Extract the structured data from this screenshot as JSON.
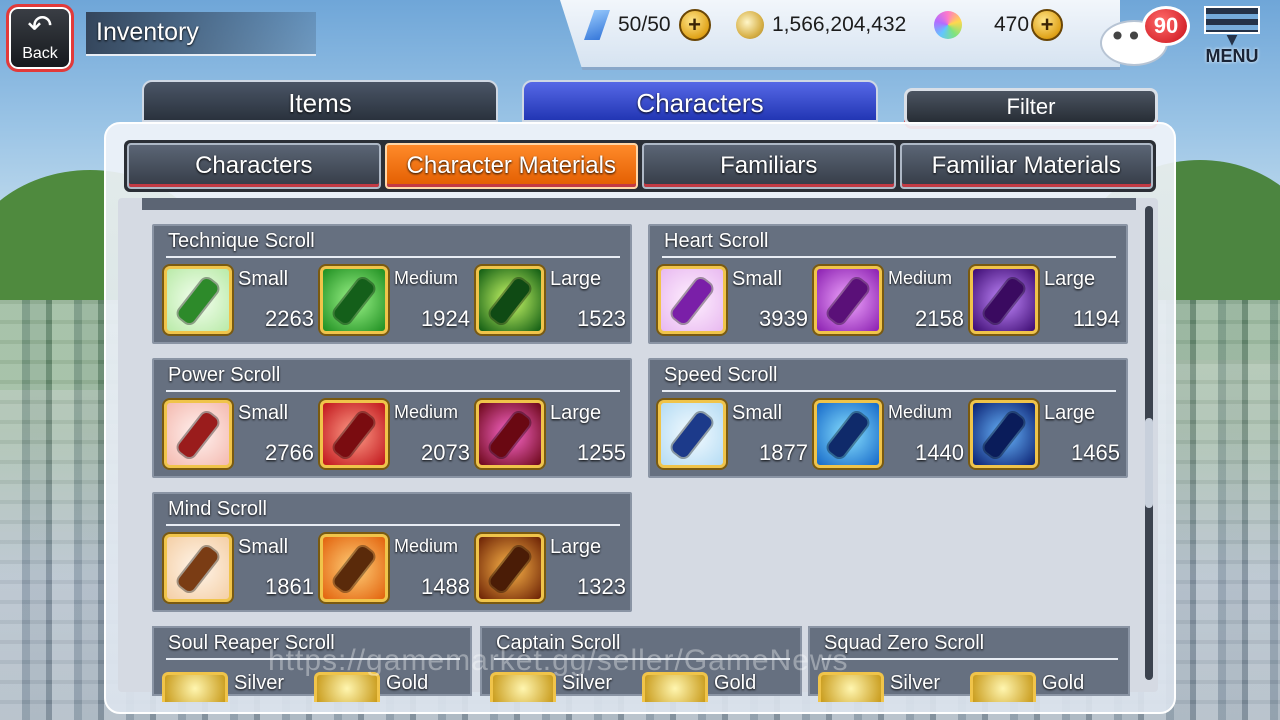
{
  "header": {
    "back_label": "Back",
    "title": "Inventory",
    "stamina": "50/50",
    "coins": "1,566,204,432",
    "orbs": "470",
    "notification_count": "90",
    "menu_label": "MENU"
  },
  "main_tabs": {
    "items": "Items",
    "characters": "Characters",
    "filter": "Filter"
  },
  "sub_tabs": [
    "Characters",
    "Character Materials",
    "Familiars",
    "Familiar Materials"
  ],
  "active_sub_tab": "Character Materials",
  "groups": [
    {
      "title": "Technique Scroll",
      "items": [
        {
          "size": "Small",
          "count": "2263"
        },
        {
          "size": "Medium",
          "count": "1924"
        },
        {
          "size": "Large",
          "count": "1523"
        }
      ]
    },
    {
      "title": "Heart Scroll",
      "items": [
        {
          "size": "Small",
          "count": "3939"
        },
        {
          "size": "Medium",
          "count": "2158"
        },
        {
          "size": "Large",
          "count": "1194"
        }
      ]
    },
    {
      "title": "Power Scroll",
      "items": [
        {
          "size": "Small",
          "count": "2766"
        },
        {
          "size": "Medium",
          "count": "2073"
        },
        {
          "size": "Large",
          "count": "1255"
        }
      ]
    },
    {
      "title": "Speed Scroll",
      "items": [
        {
          "size": "Small",
          "count": "1877"
        },
        {
          "size": "Medium",
          "count": "1440"
        },
        {
          "size": "Large",
          "count": "1465"
        }
      ]
    },
    {
      "title": "Mind Scroll",
      "items": [
        {
          "size": "Small",
          "count": "1861"
        },
        {
          "size": "Medium",
          "count": "1488"
        },
        {
          "size": "Large",
          "count": "1323"
        }
      ]
    }
  ],
  "bottom_groups": [
    {
      "title": "Soul Reaper Scroll",
      "items": [
        "Silver",
        "Gold"
      ]
    },
    {
      "title": "Captain Scroll",
      "items": [
        "Silver",
        "Gold"
      ]
    },
    {
      "title": "Squad Zero Scroll",
      "items": [
        "Silver",
        "Gold"
      ]
    }
  ],
  "watermark": "https://gamemarket.gg/seller/GameNews",
  "icons": {
    "back": "back-arrow-icon",
    "stamina": "stamina-vial-icon",
    "coins": "coin-icon",
    "orbs": "spirit-orb-icon",
    "plus": "plus-icon",
    "chat": "chat-bubble-icon",
    "menu": "menu-icon"
  }
}
